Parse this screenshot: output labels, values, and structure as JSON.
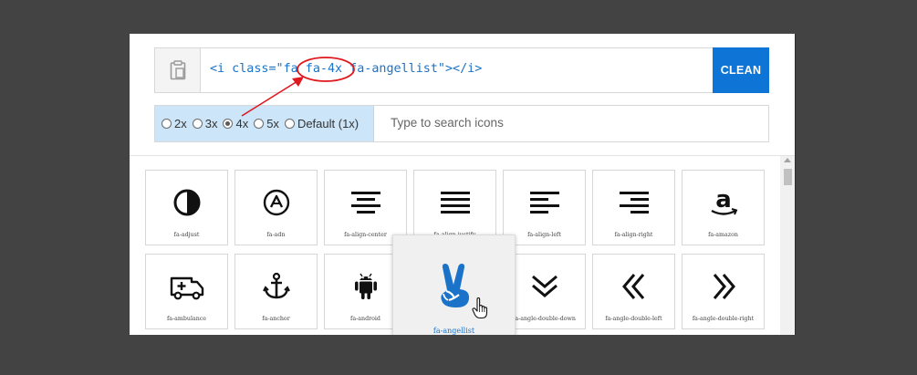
{
  "code_bar": {
    "code": "<i class=\"fa fa-4x fa-angellist\"></i>",
    "clean_label": "CLEAN"
  },
  "size_options": [
    {
      "label": "2x",
      "checked": false
    },
    {
      "label": "3x",
      "checked": false
    },
    {
      "label": "4x",
      "checked": true
    },
    {
      "label": "5x",
      "checked": false
    },
    {
      "label": "Default (1x)",
      "checked": false
    }
  ],
  "search": {
    "placeholder": "Type to search icons"
  },
  "icons": [
    {
      "name": "fa-adjust"
    },
    {
      "name": "fa-adn"
    },
    {
      "name": "fa-align-center"
    },
    {
      "name": "fa-align-justify"
    },
    {
      "name": "fa-align-left"
    },
    {
      "name": "fa-align-right"
    },
    {
      "name": "fa-amazon"
    },
    {
      "name": "fa-ambulance"
    },
    {
      "name": "fa-anchor"
    },
    {
      "name": "fa-android"
    },
    {
      "name": "fa-angellist"
    },
    {
      "name": "fa-angle-double-down"
    },
    {
      "name": "fa-angle-double-left"
    },
    {
      "name": "fa-angle-double-right"
    }
  ],
  "hovered_icon": "fa-angellist",
  "colors": {
    "accent": "#0e75d6",
    "annotation": "#e0171d",
    "code_text": "#1a73c9"
  }
}
